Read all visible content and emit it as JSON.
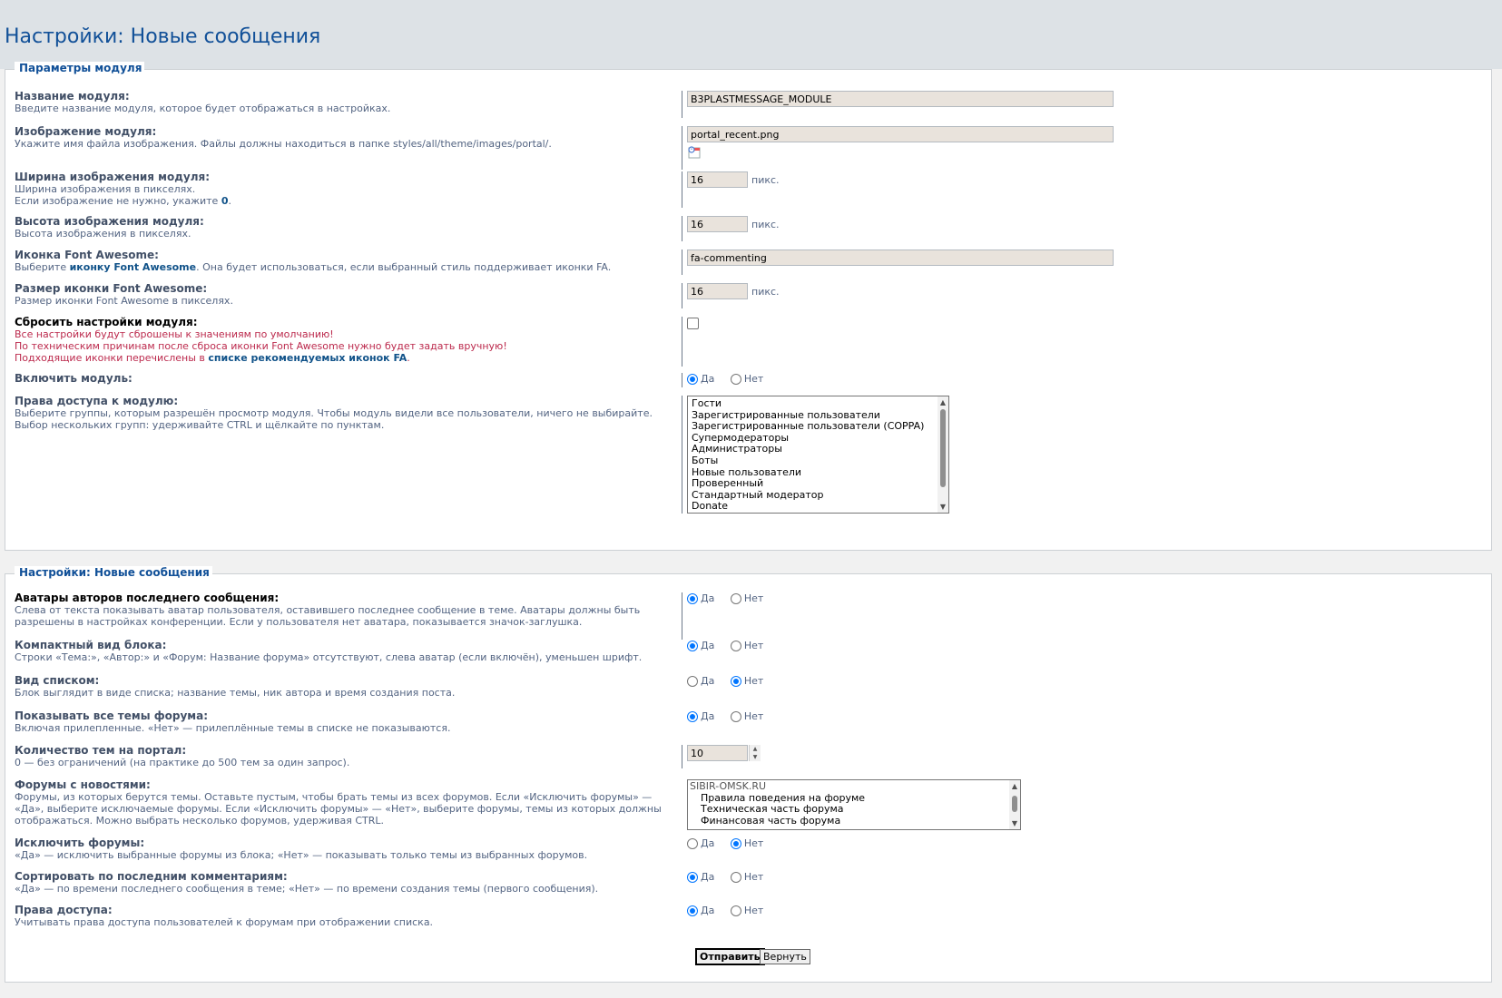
{
  "page": {
    "title": "Настройки: Новые сообщения"
  },
  "module_params": {
    "legend": "Параметры модуля",
    "name": {
      "label": "Название модуля:",
      "desc": "Введите название модуля, которое будет отображаться в настройках.",
      "value": "B3PLASTMESSAGE_MODULE"
    },
    "image": {
      "label": "Изображение модуля:",
      "desc": "Укажите имя файла изображения. Файлы должны находиться в папке styles/all/theme/images/portal/.",
      "value": "portal_recent.png",
      "icon": "broken-image-icon"
    },
    "image_width": {
      "label": "Ширина изображения модуля:",
      "desc1": "Ширина изображения в пикселях.",
      "desc2_pre": "Если изображение не нужно, укажите ",
      "desc2_bold": "0",
      "desc2_post": ".",
      "value": "16",
      "unit": "пикс."
    },
    "image_height": {
      "label": "Высота изображения модуля:",
      "desc": "Высота изображения в пикселях.",
      "value": "16",
      "unit": "пикс."
    },
    "fa_icon": {
      "label": "Иконка Font Awesome:",
      "desc_pre": "Выберите ",
      "desc_link": "иконку Font Awesome",
      "desc_post": ". Она будет использоваться, если выбранный стиль поддерживает иконки FA.",
      "value": "fa-commenting"
    },
    "fa_size": {
      "label": "Размер иконки Font Awesome:",
      "desc": "Размер иконки Font Awesome в пикселях.",
      "value": "16",
      "unit": "пикс."
    },
    "reset": {
      "label": "Сбросить настройки модуля:",
      "desc1": "Все настройки будут сброшены к значениям по умолчанию!",
      "desc2": "По техническим причинам после сброса иконки Font Awesome нужно будет задать вручную!",
      "desc3_pre": "Подходящие иконки перечислены в ",
      "desc3_link": "списке рекомендуемых иконок FA",
      "desc3_post": ".",
      "checked": false
    },
    "enable": {
      "label": "Включить модуль:",
      "yes": "Да",
      "no": "Нет",
      "value": "yes"
    },
    "permissions": {
      "label": "Права доступа к модулю:",
      "desc1": "Выберите группы, которым разрешён просмотр модуля. Чтобы модуль видели все пользователи, ничего не выбирайте.",
      "desc2": "Выбор нескольких групп: удерживайте CTRL и щёлкайте по пунктам.",
      "options": [
        "Гости",
        "Зарегистрированные пользователи",
        "Зарегистрированные пользователи (COPPA)",
        "Супермодераторы",
        "Администраторы",
        "Боты",
        "Новые пользователи",
        "Проверенный",
        "Стандартный модератор",
        "Donate"
      ]
    }
  },
  "block_settings": {
    "legend": "Настройки: Новые сообщения",
    "avatars": {
      "label": "Аватары авторов последнего сообщения:",
      "desc": "Слева от текста показывать аватар пользователя, оставившего последнее сообщение в теме. Аватары должны быть разрешены в настройках конференции. Если у пользователя нет аватара, показывается значок-заглушка.",
      "yes": "Да",
      "no": "Нет",
      "value": "yes"
    },
    "compact": {
      "label": "Компактный вид блока:",
      "desc": "Строки «Тема:», «Автор:» и «Форум: Название форума» отсутствуют, слева аватар (если включён), уменьшен шрифт.",
      "yes": "Да",
      "no": "Нет",
      "value": "yes"
    },
    "list_view": {
      "label": "Вид списком:",
      "desc": "Блок выглядит в виде списка; название темы, ник автора и время создания поста.",
      "yes": "Да",
      "no": "Нет",
      "value": "no"
    },
    "show_all": {
      "label": "Показывать все темы форума:",
      "desc": "Включая прилепленные. «Нет» — прилеплённые темы в списке не показываются.",
      "yes": "Да",
      "no": "Нет",
      "value": "yes"
    },
    "topic_count": {
      "label": "Количество тем на портал:",
      "desc": "0 — без ограничений (на практике до 500 тем за один запрос).",
      "value": "10"
    },
    "news_forums": {
      "label": "Форумы с новостями:",
      "desc": "Форумы, из которых берутся темы. Оставьте пустым, чтобы брать темы из всех форумов. Если «Исключить форумы» — «Да», выберите исключаемые форумы. Если «Исключить форумы» — «Нет», выберите форумы, темы из которых должны отображаться. Можно выбрать несколько форумов, удерживая CTRL.",
      "group": "SIBIR-OMSK.RU",
      "options": [
        "Правила поведения на форуме",
        "Техническая часть форума",
        "Финансовая часть форума"
      ]
    },
    "exclude": {
      "label": "Исключить форумы:",
      "desc": "«Да» — исключить выбранные форумы из блока; «Нет» — показывать только темы из выбранных форумов.",
      "yes": "Да",
      "no": "Нет",
      "value": "no"
    },
    "sort_last": {
      "label": "Сортировать по последним комментариям:",
      "desc": "«Да» — по времени последнего сообщения в теме; «Нет» — по времени создания темы (первого сообщения).",
      "yes": "Да",
      "no": "Нет",
      "value": "yes"
    },
    "access": {
      "label": "Права доступа:",
      "desc": "Учитывать права доступа пользователей к форумам при отображении списка.",
      "yes": "Да",
      "no": "Нет",
      "value": "yes"
    }
  },
  "buttons": {
    "submit": "Отправить",
    "reset": "Вернуть"
  }
}
